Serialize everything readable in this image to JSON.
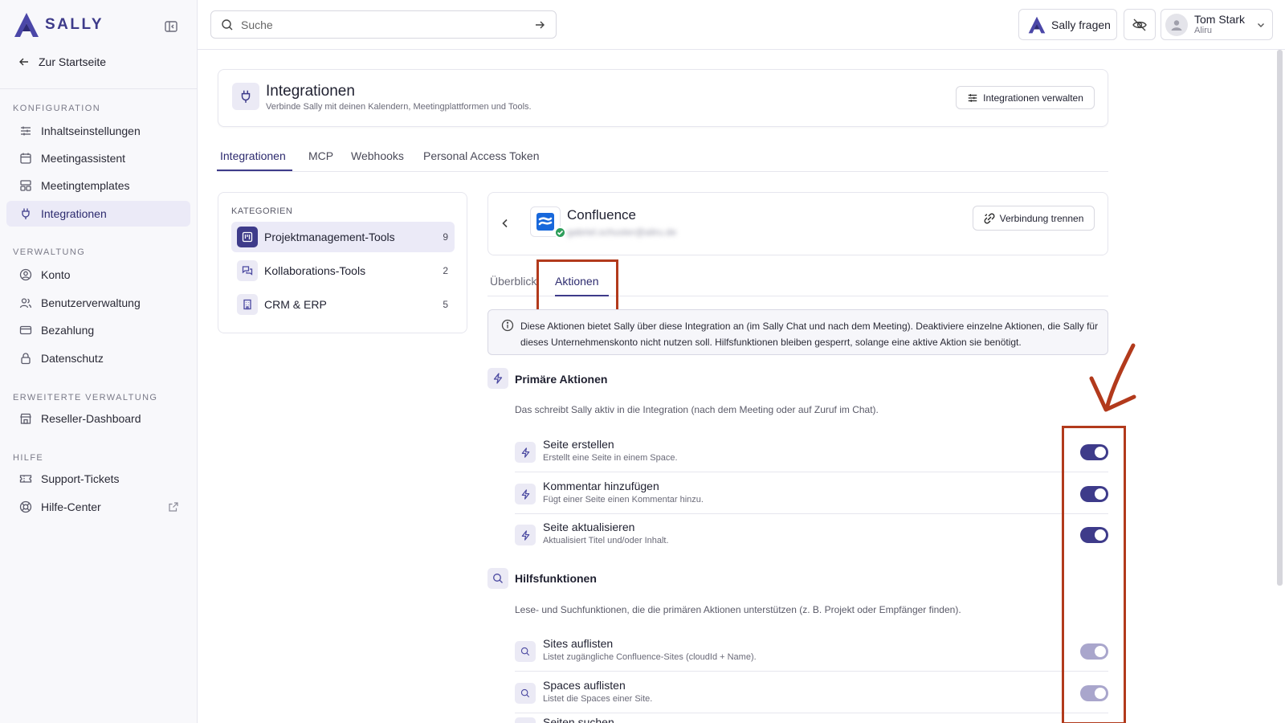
{
  "brand": {
    "name": "SALLY",
    "accent": "#3e3b8a"
  },
  "sidebar": {
    "back_label": "Zur Startseite",
    "sections": [
      {
        "title": "KONFIGURATION",
        "items": [
          {
            "label": "Inhaltseinstellungen",
            "icon": "sliders-icon"
          },
          {
            "label": "Meetingassistent",
            "icon": "calendar-icon"
          },
          {
            "label": "Meetingtemplates",
            "icon": "template-icon"
          },
          {
            "label": "Integrationen",
            "icon": "plug-icon",
            "active": true
          }
        ]
      },
      {
        "title": "VERWALTUNG",
        "items": [
          {
            "label": "Konto",
            "icon": "user-circle-icon"
          },
          {
            "label": "Benutzerverwaltung",
            "icon": "users-icon"
          },
          {
            "label": "Bezahlung",
            "icon": "credit-card-icon"
          },
          {
            "label": "Datenschutz",
            "icon": "lock-icon"
          }
        ]
      },
      {
        "title": "ERWEITERTE VERWALTUNG",
        "items": [
          {
            "label": "Reseller-Dashboard",
            "icon": "store-icon"
          }
        ]
      },
      {
        "title": "HILFE",
        "items": [
          {
            "label": "Support-Tickets",
            "icon": "ticket-icon"
          },
          {
            "label": "Hilfe-Center",
            "icon": "lifebuoy-icon",
            "external": true
          }
        ]
      }
    ]
  },
  "topbar": {
    "search_placeholder": "Suche",
    "ask_label": "Sally fragen",
    "user": {
      "name": "Tom Stark",
      "org": "Aliru"
    }
  },
  "page": {
    "title": "Integrationen",
    "subtitle": "Verbinde Sally mit deinen Kalendern, Meetingplattformen und Tools.",
    "manage_label": "Integrationen verwalten",
    "tabs": [
      "Integrationen",
      "MCP",
      "Webhooks",
      "Personal Access Token"
    ],
    "active_tab": "Integrationen"
  },
  "categories": {
    "heading": "KATEGORIEN",
    "items": [
      {
        "label": "Projektmanagement-Tools",
        "count": "9",
        "active": true
      },
      {
        "label": "Kollaborations-Tools",
        "count": "2"
      },
      {
        "label": "CRM & ERP",
        "count": "5"
      }
    ]
  },
  "connection": {
    "name": "Confluence",
    "account": "gabriel.schuster@aliru.de",
    "disconnect_label": "Verbindung trennen",
    "subtabs": [
      "Überblick",
      "Aktionen"
    ],
    "active_subtab": "Aktionen"
  },
  "info": "Diese Aktionen bietet Sally über diese Integration an (im Sally Chat und nach dem Meeting). Deaktiviere einzelne Aktionen, die Sally für dieses Unternehmenskonto nicht nutzen soll. Hilfsfunktionen bleiben gesperrt, solange eine aktive Aktion sie benötigt.",
  "primary": {
    "title": "Primäre Aktionen",
    "description": "Das schreibt Sally aktiv in die Integration (nach dem Meeting oder auf Zuruf im Chat).",
    "actions": [
      {
        "title": "Seite erstellen",
        "description": "Erstellt eine Seite in einem Space.",
        "enabled": true
      },
      {
        "title": "Kommentar hinzufügen",
        "description": "Fügt einer Seite einen Kommentar hinzu.",
        "enabled": true
      },
      {
        "title": "Seite aktualisieren",
        "description": "Aktualisiert Titel und/oder Inhalt.",
        "enabled": true
      }
    ]
  },
  "helpers": {
    "title": "Hilfsfunktionen",
    "description": "Lese- und Suchfunktionen, die die primären Aktionen unterstützen (z. B. Projekt oder Empfänger finden).",
    "actions": [
      {
        "title": "Sites auflisten",
        "description": "Listet zugängliche Confluence-Sites (cloudId + Name).",
        "enabled": true,
        "locked": true
      },
      {
        "title": "Spaces auflisten",
        "description": "Listet die Spaces einer Site.",
        "enabled": true,
        "locked": true
      },
      {
        "title": "Seiten suchen",
        "description": "",
        "enabled": true,
        "locked": true
      }
    ]
  },
  "annotation_color": "#b23a1c"
}
